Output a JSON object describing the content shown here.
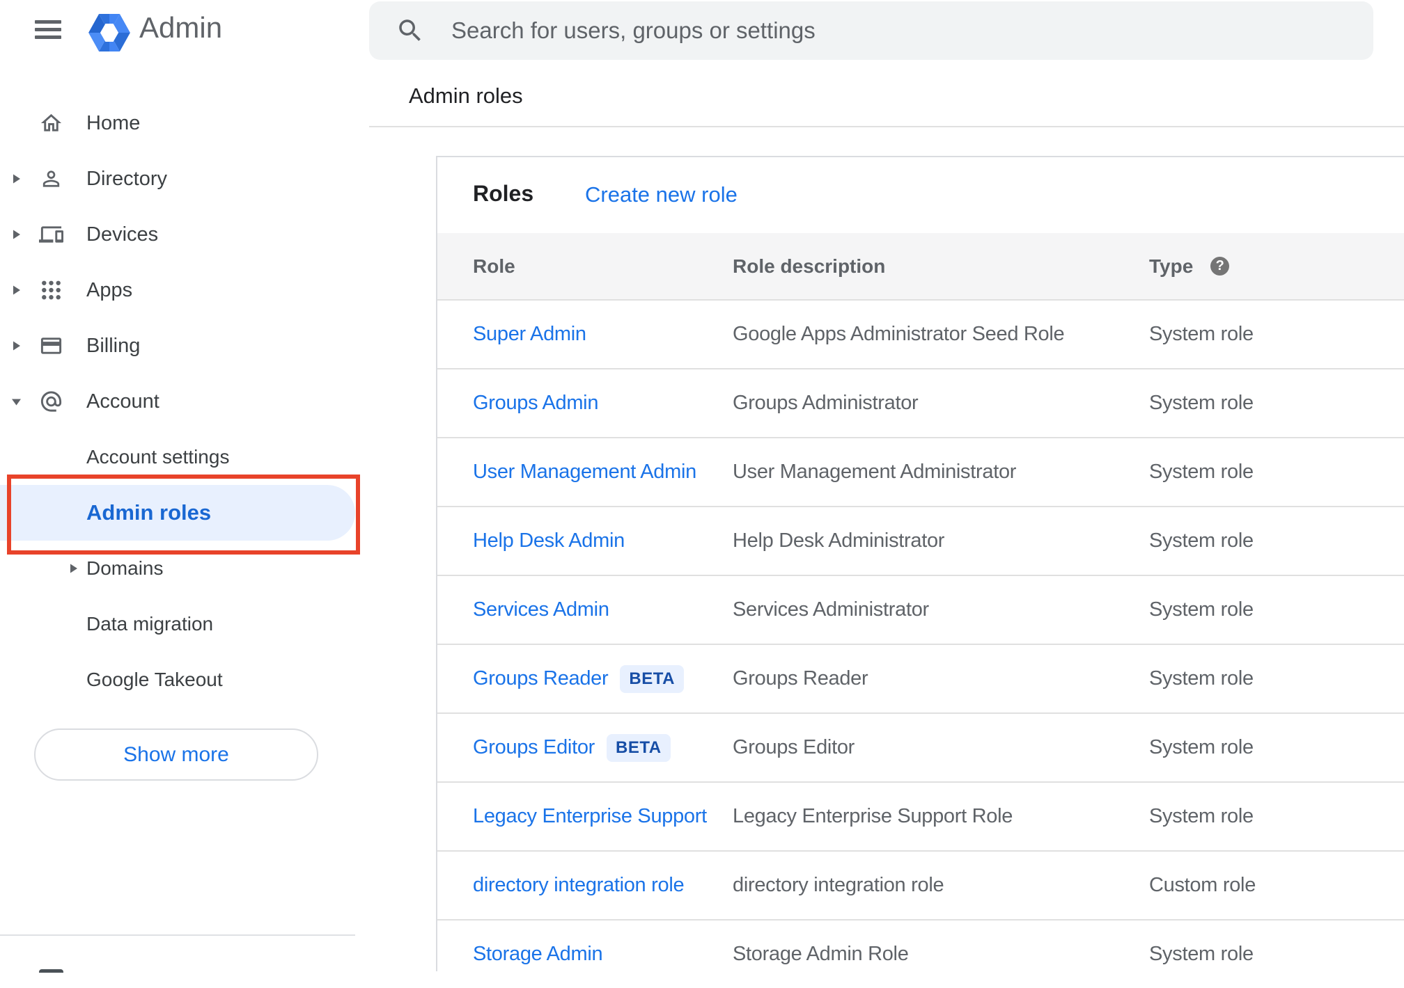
{
  "app": {
    "product_name": "Admin"
  },
  "topbar": {
    "search_placeholder": "Search for users, groups or settings"
  },
  "page": {
    "title": "Admin roles"
  },
  "sidebar": {
    "items": [
      {
        "label": "Home",
        "icon": "home",
        "expandable": false
      },
      {
        "label": "Directory",
        "icon": "person",
        "expandable": true
      },
      {
        "label": "Devices",
        "icon": "devices",
        "expandable": true
      },
      {
        "label": "Apps",
        "icon": "apps-grid",
        "expandable": true
      },
      {
        "label": "Billing",
        "icon": "credit-card",
        "expandable": true
      },
      {
        "label": "Account",
        "icon": "at-sign",
        "expandable": true,
        "expanded": true
      }
    ],
    "account_children": [
      {
        "label": "Account settings"
      },
      {
        "label": "Admin roles",
        "selected": true
      },
      {
        "label": "Domains",
        "expandable": true
      },
      {
        "label": "Data migration"
      },
      {
        "label": "Google Takeout"
      }
    ],
    "show_more_label": "Show more"
  },
  "content": {
    "card_title": "Roles",
    "create_link_label": "Create new role",
    "table": {
      "columns": [
        "Role",
        "Role description",
        "Type"
      ],
      "help_icon": "?",
      "rows": [
        {
          "role": "Super Admin",
          "badge": "",
          "description": "Google Apps Administrator Seed Role",
          "type": "System role"
        },
        {
          "role": "Groups Admin",
          "badge": "",
          "description": "Groups Administrator",
          "type": "System role"
        },
        {
          "role": "User Management Admin",
          "badge": "",
          "description": "User Management Administrator",
          "type": "System role"
        },
        {
          "role": "Help Desk Admin",
          "badge": "",
          "description": "Help Desk Administrator",
          "type": "System role"
        },
        {
          "role": "Services Admin",
          "badge": "",
          "description": "Services Administrator",
          "type": "System role"
        },
        {
          "role": "Groups Reader",
          "badge": "BETA",
          "description": "Groups Reader",
          "type": "System role"
        },
        {
          "role": "Groups Editor",
          "badge": "BETA",
          "description": "Groups Editor",
          "type": "System role"
        },
        {
          "role": "Legacy Enterprise Support",
          "badge": "",
          "description": "Legacy Enterprise Support Role",
          "type": "System role"
        },
        {
          "role": "directory integration role",
          "badge": "",
          "description": "directory integration role",
          "type": "Custom role"
        },
        {
          "role": "Storage Admin",
          "badge": "",
          "description": "Storage Admin Role",
          "type": "System role"
        }
      ]
    }
  },
  "annotation": {
    "highlight_color": "#e8432a",
    "highlighted_item": "Admin roles"
  },
  "colors": {
    "link_blue": "#1a73e8",
    "selected_nav_blue": "#1967d2",
    "selected_nav_bg": "#e8f0fe",
    "beta_badge_bg": "#e8f0fe",
    "beta_badge_text": "#174ea6",
    "text_primary": "#202124",
    "text_secondary": "#5f6368",
    "search_bg": "#f1f3f4",
    "table_header_bg": "#f5f5f6",
    "divider": "#e0e0e0"
  }
}
